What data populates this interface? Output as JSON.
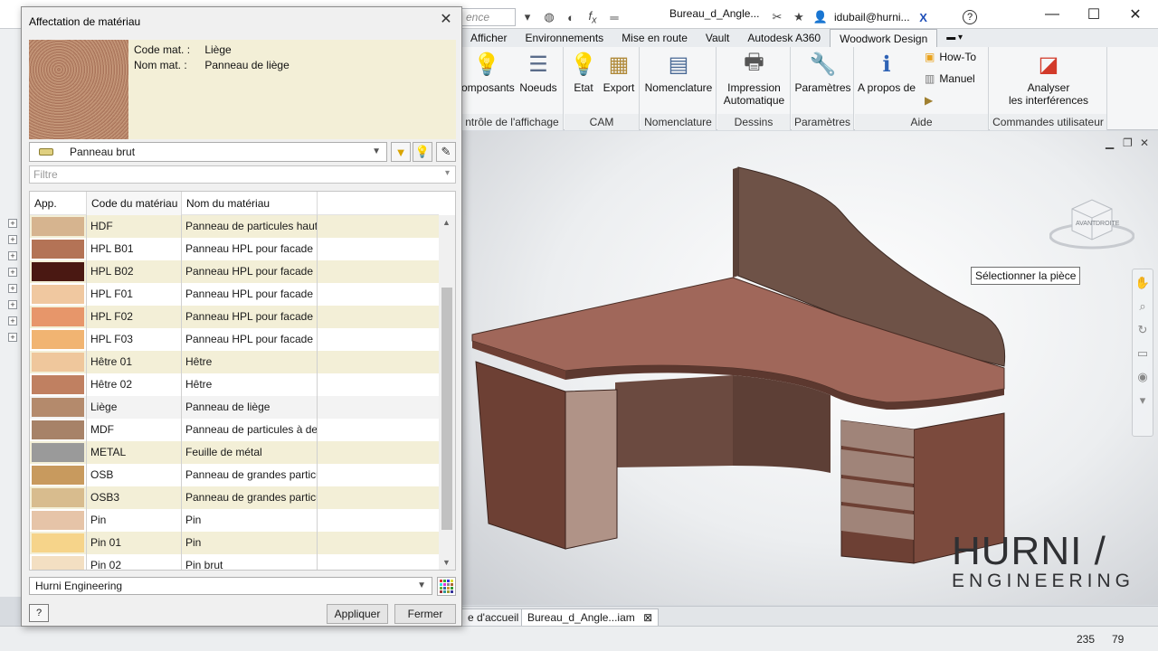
{
  "window": {
    "search_placeholder": "ence",
    "doc_title": "Bureau_d_Angle...",
    "user": "idubail@hurni...",
    "help_icon": "question-icon"
  },
  "ribbon": {
    "tabs": [
      "Afficher",
      "Environnements",
      "Mise en route",
      "Vault",
      "Autodesk A360",
      "Woodwork Design"
    ],
    "active_tab": "Woodwork Design",
    "buttons": {
      "composants": "omposants",
      "noeuds": "Noeuds",
      "etat": "Etat",
      "export": "Export",
      "nomenclature": "Nomenclature",
      "impression_l1": "Impression",
      "impression_l2": "Automatique",
      "parametres": "Paramètres",
      "apropos": "A propos de",
      "howto": "How-To",
      "manuel": "Manuel",
      "analyser_l1": "Analyser",
      "analyser_l2": "les interférences"
    },
    "groups": {
      "controle": "ntrôle de l'affichage",
      "cam": "CAM",
      "nomenclature": "Nomenclature",
      "dessins": "Dessins",
      "parametres": "Paramètres",
      "aide": "Aide",
      "commandes": "Commandes utilisateur"
    }
  },
  "viewport": {
    "tooltip": "Sélectionner la pièce",
    "viewcube_left": "AVANT",
    "viewcube_right": "DROITE",
    "brand_line1": "HURNI",
    "brand_line2": "ENGINEERING"
  },
  "doc_tabs": {
    "home": "e d'accueil",
    "doc": "Bureau_d_Angle...iam"
  },
  "status": {
    "x": "235",
    "y": "79"
  },
  "dialog": {
    "title": "Affectation de matériau",
    "code_label": "Code mat. :",
    "code_value": "Liège",
    "name_label": "Nom mat. :",
    "name_value": "Panneau de liège",
    "combo_value": "Panneau brut",
    "filter_placeholder": "Filtre",
    "columns": [
      "App.",
      "Code du matériau",
      "Nom du matériau"
    ],
    "rows": [
      {
        "code": "HDF",
        "name": "Panneau de particules haut",
        "color": "#d6b48f"
      },
      {
        "code": "HPL B01",
        "name": "Panneau HPL pour facade E",
        "color": "#b47356"
      },
      {
        "code": "HPL B02",
        "name": "Panneau HPL pour facade E",
        "color": "#4a1812"
      },
      {
        "code": "HPL F01",
        "name": "Panneau HPL pour facade F",
        "color": "#f0c8a0"
      },
      {
        "code": "HPL F02",
        "name": "Panneau HPL pour facade F",
        "color": "#e7966a"
      },
      {
        "code": "HPL F03",
        "name": "Panneau HPL pour facade F",
        "color": "#f1b472"
      },
      {
        "code": "Hêtre 01",
        "name": "Hêtre",
        "color": "#efc79c"
      },
      {
        "code": "Hêtre 02",
        "name": "Hêtre",
        "color": "#c08061"
      },
      {
        "code": "Liège",
        "name": "Panneau de liège",
        "color": "#b48a6c"
      },
      {
        "code": "MDF",
        "name": "Panneau de particules à de",
        "color": "#a78268"
      },
      {
        "code": "METAL",
        "name": "Feuille de métal",
        "color": "#9a9a9a"
      },
      {
        "code": "OSB",
        "name": "Panneau de grandes particu",
        "color": "#c89a5e"
      },
      {
        "code": "OSB3",
        "name": "Panneau de grandes particu",
        "color": "#d8bc8e"
      },
      {
        "code": "Pin",
        "name": "Pin",
        "color": "#e6c4a8"
      },
      {
        "code": "Pin 01",
        "name": "Pin",
        "color": "#f6d48a"
      },
      {
        "code": "Pin 02",
        "name": "Pin brut",
        "color": "#f3dfc2"
      }
    ],
    "selected_code": "Liège",
    "library": "Hurni Engineering",
    "apply": "Appliquer",
    "close": "Fermer"
  }
}
